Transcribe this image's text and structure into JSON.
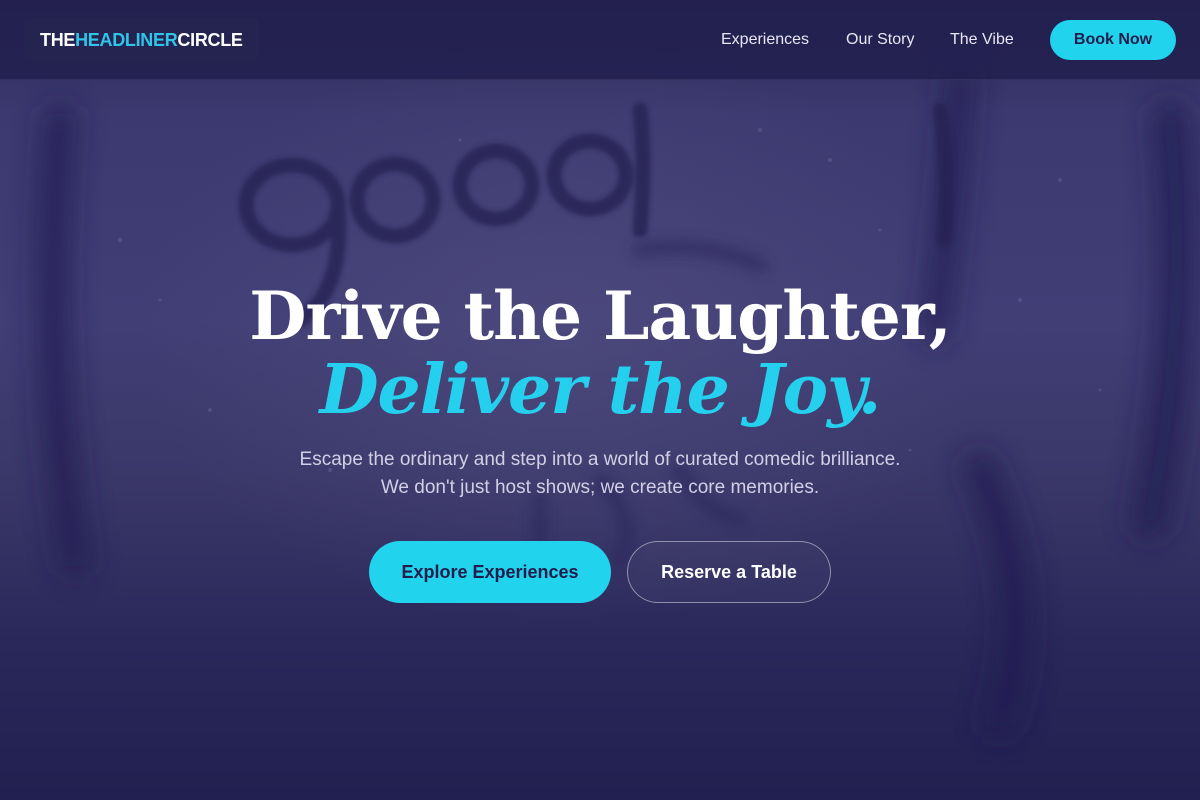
{
  "brand": {
    "name_part1": "THE ",
    "name_accent": "HEADLINER",
    "name_part2": " CIRCLE"
  },
  "nav": {
    "links": [
      "Experiences",
      "Our Story",
      "The Vibe"
    ],
    "cta": "Book Now"
  },
  "hero": {
    "title_line1": "Drive the Laughter,",
    "title_line2": "Deliver the Joy.",
    "subtitle": "Escape the ordinary and step into a world of curated comedic brilliance. We don't just host shows; we create core memories.",
    "primary_cta": "Explore Experiences",
    "secondary_cta": "Reserve a Table"
  },
  "colors": {
    "background": "#22204f",
    "accent": "#22d3ee",
    "text": "#ffffff"
  }
}
